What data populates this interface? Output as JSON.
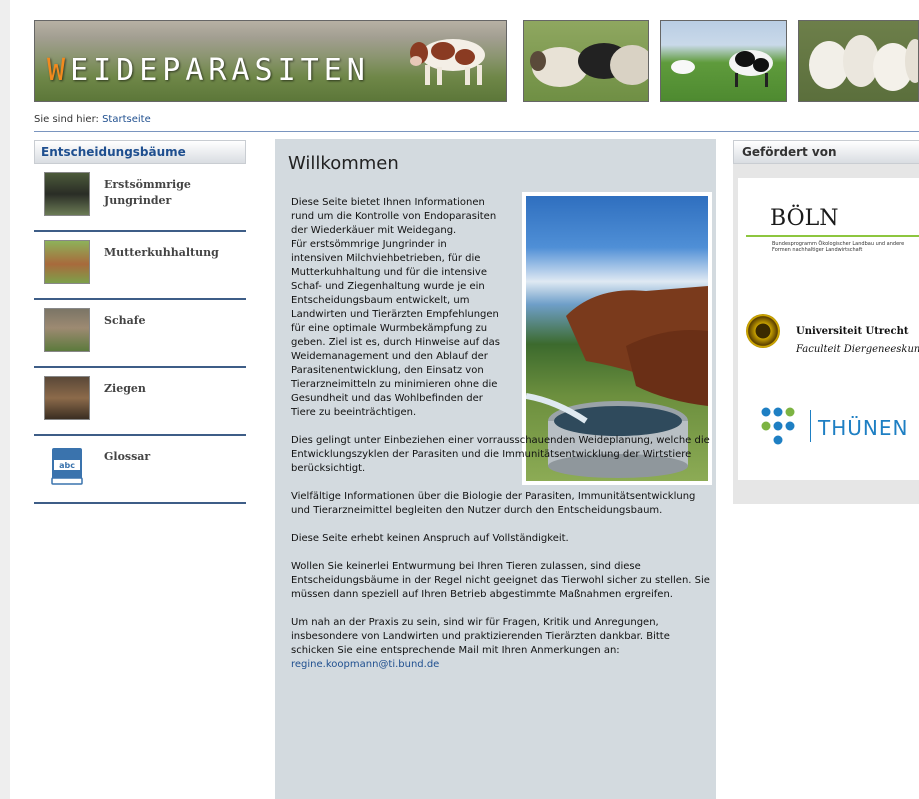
{
  "header": {
    "logo_first_letter": "W",
    "logo_rest": "EIDEPARASITEN"
  },
  "breadcrumb": {
    "prefix": "Sie sind hier:",
    "link": "Startseite"
  },
  "nav": {
    "title": "Entscheidungsbäume",
    "items": [
      {
        "label": "Erstsömmrige Jungrinder",
        "icon": "heifer-photo"
      },
      {
        "label": "Mutterkuhhaltung",
        "icon": "suckler-cow-photo"
      },
      {
        "label": "Schafe",
        "icon": "sheep-photo"
      },
      {
        "label": "Ziegen",
        "icon": "goat-photo"
      },
      {
        "label": "Glossar",
        "icon": "book-icon"
      }
    ]
  },
  "main": {
    "title": "Willkommen",
    "paragraphs": [
      "Diese Seite bietet Ihnen Informationen rund um die Kontrolle von Endoparasiten der Wiederkäuer mit Weidegang.",
      "Für erstsömmrige Jungrinder in intensiven Milchviehbetrieben, für die Mutterkuhhaltung und für die intensive Schaf- und Ziegenhaltung wurde je ein Entscheidungsbaum entwickelt, um Landwirten und Tierärzten Empfehlungen für eine optimale Wurmbekämpfung zu geben. Ziel ist es, durch Hinweise auf das Weidemanagement und den Ablauf der Parasitenentwicklung, den Einsatz von Tierarzneimitteln zu minimieren ohne die Gesundheit und das Wohlbefinden der Tiere zu beeinträchtigen.",
      "Dies gelingt unter Einbeziehen einer vorrausschauenden Weideplanung, welche die Entwicklungszyklen der Parasiten und die Immunitätsentwicklung der Wirtstiere berücksichtigt.",
      "Vielfältige Informationen über die Biologie der Parasiten, Immunitätsentwicklung und Tierarzneimittel begleiten den Nutzer durch den Entscheidungsbaum.",
      "Diese Seite erhebt keinen Anspruch auf Vollständigkeit.",
      "Wollen Sie keinerlei Entwurmung bei Ihren Tieren zulassen, sind diese Entscheidungsbäume in der Regel nicht geeignet das Tierwohl sicher zu stellen. Sie müssen dann speziell auf Ihren Betrieb abgestimmte Maßnahmen ergreifen.",
      "Um nah an der Praxis zu sein, sind wir für Fragen, Kritik und Anregungen, insbesondere von Landwirten und praktizierenden Tierärzten dankbar. Bitte schicken Sie eine entsprechende Mail mit Ihren Anmerkungen an:"
    ],
    "email": "regine.koopmann@ti.bund.de"
  },
  "sidebar": {
    "title": "Gefördert von",
    "boeln": {
      "name": "BÖLN",
      "subtitle": "Bundesprogramm Ökologischer Landbau und andere Formen nachhaltiger Landwirtschaft"
    },
    "utrecht": {
      "name": "Universiteit Utrecht",
      "faculty": "Faculteit Diergeneeskunde"
    },
    "thuenen": {
      "name": "THÜNEN"
    }
  },
  "colors": {
    "link": "#1f4f8f",
    "nav_divider": "#3e5d87",
    "main_bg": "#d3dadf",
    "logo_accent": "#f28a1e",
    "thuenen_blue": "#1e7fc3",
    "boeln_green": "#8dc63f"
  }
}
